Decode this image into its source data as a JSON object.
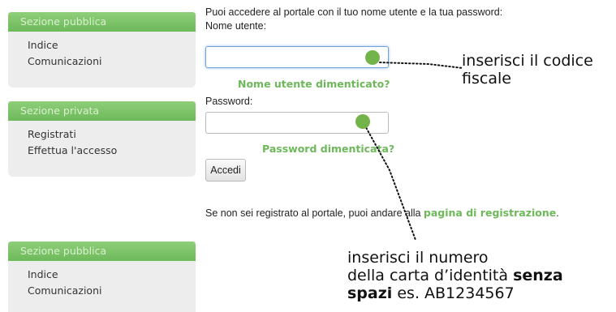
{
  "sidebar": {
    "panels": [
      {
        "title": "Sezione pubblica",
        "items": [
          "Indice",
          "Comunicazioni"
        ]
      },
      {
        "title": "Sezione privata",
        "items": [
          "Registrati",
          "Effettua l'accesso"
        ]
      },
      {
        "title": "Sezione pubblica",
        "items": [
          "Indice",
          "Comunicazioni"
        ]
      }
    ]
  },
  "login": {
    "intro": "Puoi accedere al portale con il tuo nome utente e la tua password:",
    "username_label": "Nome utente:",
    "username_value": "",
    "forgot_username": "Nome utente dimenticato?",
    "password_label": "Password:",
    "password_value": "",
    "forgot_password": "Password dimenticata?",
    "submit_label": "Accedi",
    "register_prefix": "Se non sei registrato al portale, puoi andare alla ",
    "register_link": "pagina di registrazione",
    "register_suffix": "."
  },
  "annotations": {
    "username_hint_line1": "inserisci il codice",
    "username_hint_line2": "fiscale",
    "password_hint_line1": "inserisci il numero",
    "password_hint_line2_prefix": "della carta d’identità ",
    "password_hint_bold1": "senza",
    "password_hint_bold2": "spazi",
    "password_hint_suffix": " es. AB1234567"
  },
  "colors": {
    "accent_green": "#6db95a",
    "dot_green": "#73b44a"
  }
}
